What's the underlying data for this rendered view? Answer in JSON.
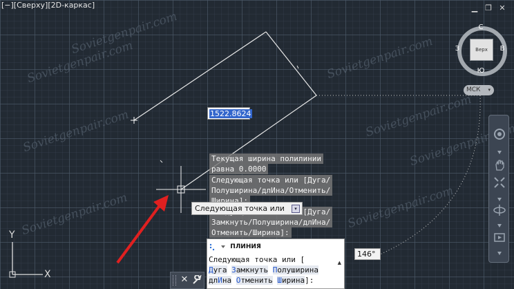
{
  "viewport": {
    "label": "[−][Сверху][2D-каркас]",
    "controls": {
      "minimize": "▁",
      "restore": "❐",
      "close": "✕"
    },
    "watermark": "Sovietgenpair.com"
  },
  "viewcube": {
    "face": "Верх",
    "north": "С",
    "south": "Ю",
    "west": "З",
    "east": "В",
    "wcs": "МСК",
    "wcs_arrow": "▾"
  },
  "navbar": {
    "icons": [
      "steering-wheel-icon",
      "pan-icon",
      "zoom-extents-icon",
      "orbit-icon",
      "showmotion-icon"
    ]
  },
  "dimension": {
    "value": "1522.8624"
  },
  "history": {
    "lines": [
      "Текущая ширина полилинии",
      "равна 0.0000",
      "Следующая точка или [Дуга/",
      "Полуширина/длИна/Отменить/",
      "Ширина]:",
      "Следующая точка или [Дуга/",
      "Замкнуть/Полуширина/длИна/",
      "Отменить/Ширина]:"
    ]
  },
  "dynamic_prompt": {
    "text": "Следующая точка или",
    "dropdown_arrow": "▾"
  },
  "angle": {
    "value": "146°"
  },
  "command_line": {
    "title": "ПЛИНИЯ",
    "prompt_prefix": "Следующая точка или [",
    "options_row1": [
      {
        "key": "Д",
        "rest": "уга"
      },
      {
        "key": "З",
        "rest": "амкнуть"
      },
      {
        "key": "П",
        "rest": "олуширина"
      }
    ],
    "options_row2": [
      {
        "prefix": "дл",
        "key": "И",
        "rest": "на"
      },
      {
        "prefix": "",
        "key": "О",
        "rest": "тменить"
      },
      {
        "prefix": "",
        "key": "Ш",
        "rest": "ирина"
      }
    ],
    "suffix": "]:",
    "scroll_arrow": "▲"
  },
  "cmd_toolbar": {
    "close": "✕",
    "customize": "🔧"
  },
  "ucs": {
    "y": "Y",
    "x": "X"
  },
  "colors": {
    "background": "#222a33",
    "line": "#e8e8e8",
    "annotation_arrow": "#e02020"
  }
}
